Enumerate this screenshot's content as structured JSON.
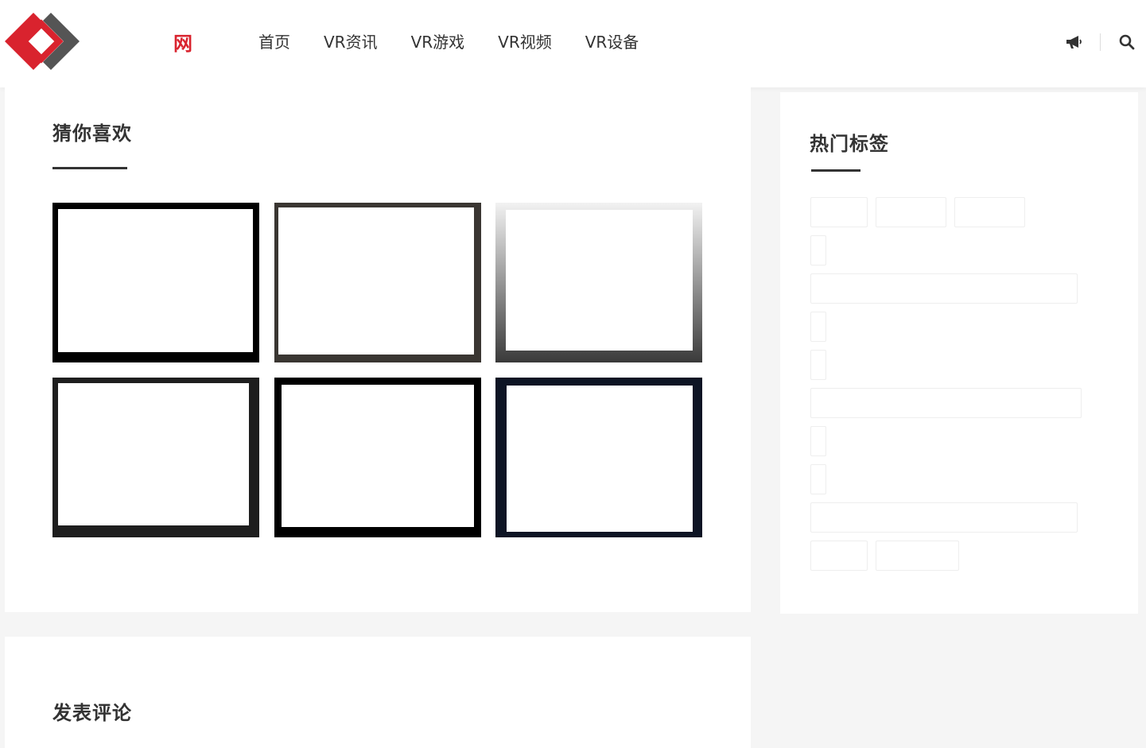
{
  "header": {
    "logo_text": "网",
    "nav": [
      "首页",
      "VR资讯",
      "VR游戏",
      "VR视频",
      "VR设备"
    ],
    "icons": {
      "announce": "megaphone-icon",
      "search": "search-icon"
    }
  },
  "colors": {
    "brand_red": "#d9232e",
    "brand_gray": "#555555",
    "text": "#333333"
  },
  "recommend": {
    "title": "猜你喜欢"
  },
  "hot_tags": {
    "title": "热门标签"
  },
  "comment": {
    "title": "发表评论"
  }
}
